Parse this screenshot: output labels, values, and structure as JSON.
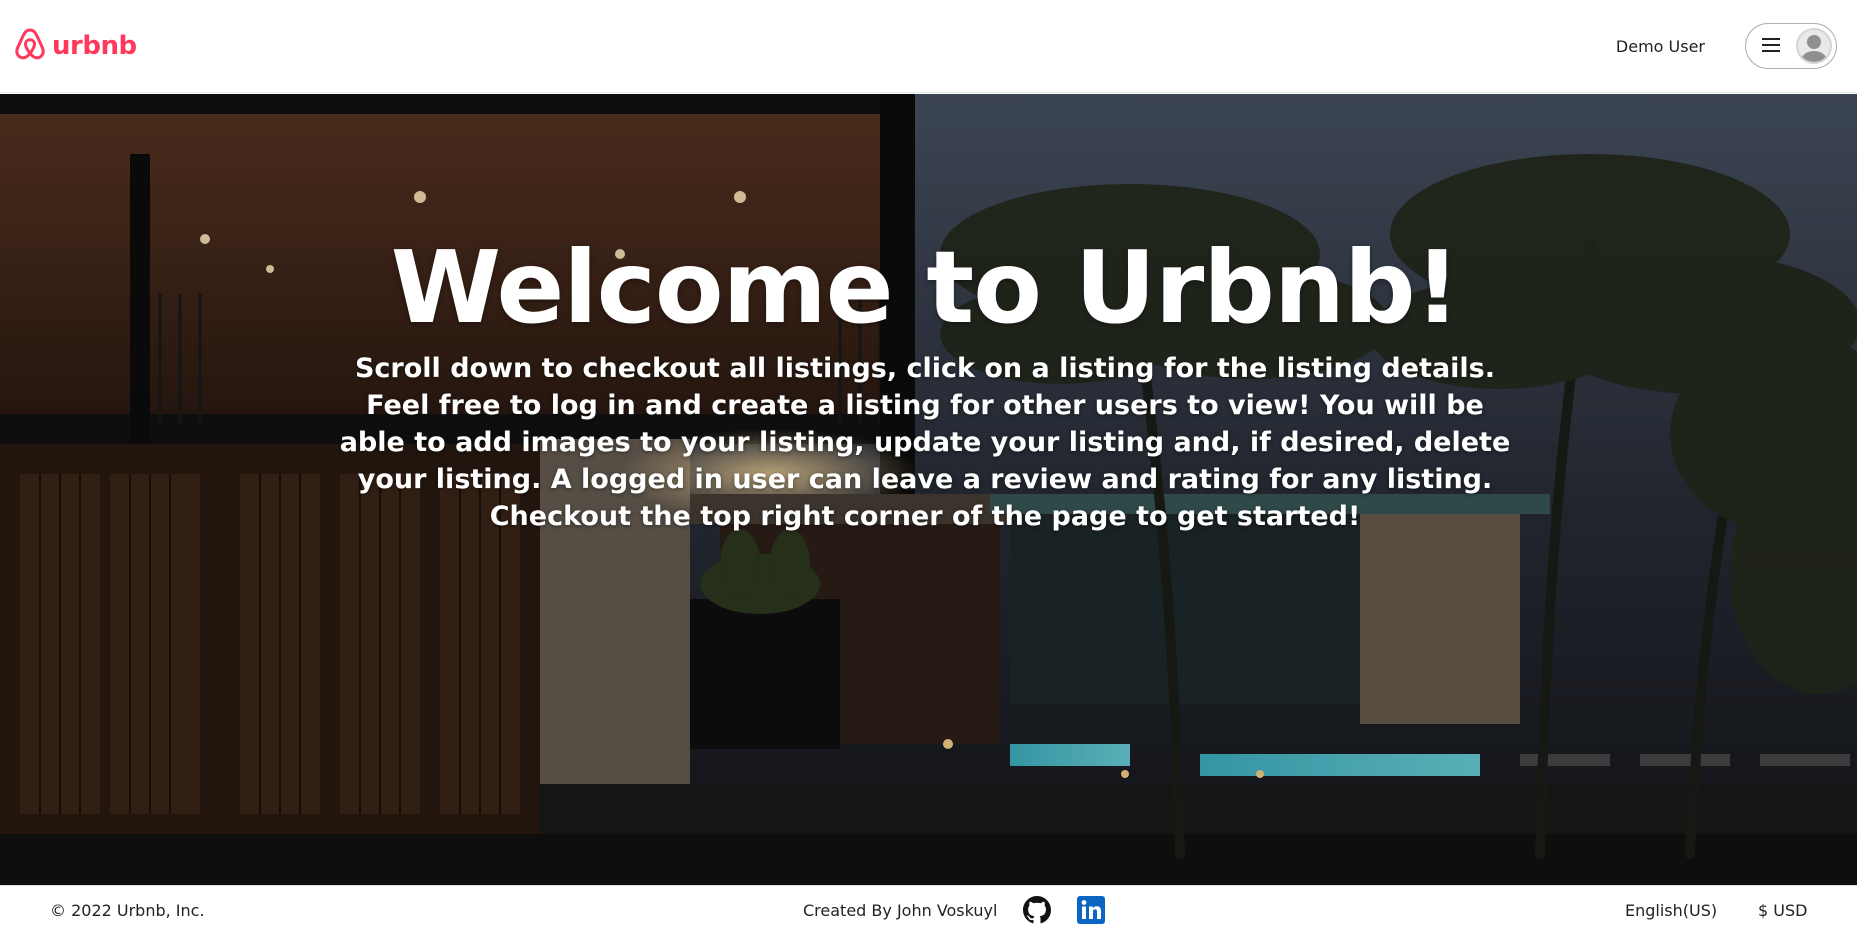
{
  "header": {
    "logo_text": "urbnb",
    "demo_user_label": "Demo User",
    "menu_icon": "hamburger-menu-icon",
    "avatar_icon": "user-avatar-icon"
  },
  "hero": {
    "title": "Welcome to Urbnb!",
    "description": "Scroll down to checkout all listings, click on a listing for the listing details. Feel free to log in and create a listing for other users to view! You will be able to add images to your listing, update your listing and, if desired, delete your listing. A logged in user can leave a review and rating for any listing. Checkout the top right corner of the page to get started!"
  },
  "footer": {
    "copyright": "© 2022 Urbnb, Inc.",
    "created_by": "Created By John Voskuyl",
    "github_icon": "github-icon",
    "linkedin_icon": "linkedin-icon",
    "language": "English(US)",
    "currency": "$ USD"
  },
  "colors": {
    "brand": "#ff385c",
    "linkedin": "#0a66c2"
  }
}
